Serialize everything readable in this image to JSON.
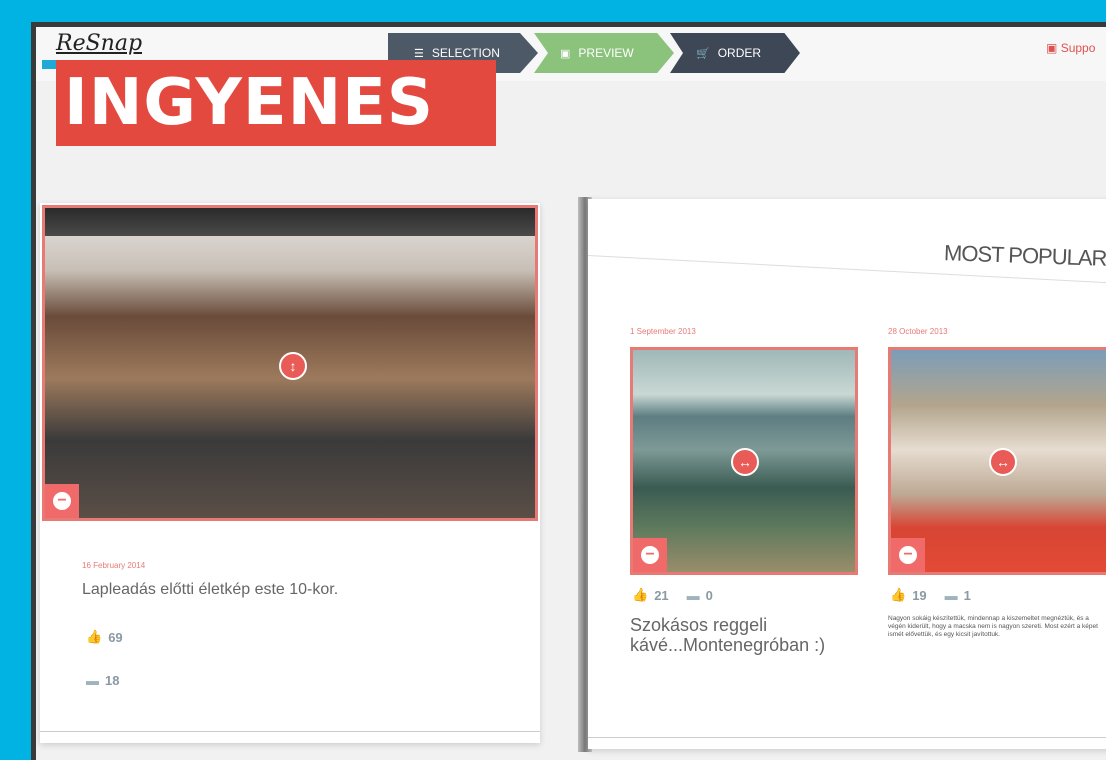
{
  "header": {
    "logo": "ReSnap",
    "steps": [
      {
        "label": "SELECTION",
        "icon": "list-icon"
      },
      {
        "label": "PREVIEW",
        "icon": "image-icon"
      },
      {
        "label": "ORDER",
        "icon": "cart-icon"
      }
    ],
    "support": "Suppo"
  },
  "badge": "INGYENES",
  "left_page": {
    "date": "16 February 2014",
    "caption": "Lapleadás előtti életkép este 10-kor.",
    "likes": "69",
    "comments": "18"
  },
  "right_page": {
    "heading": "MOST POPULAR",
    "cards": [
      {
        "date": "1 September 2013",
        "likes": "21",
        "comments": "0",
        "caption": "Szokásos reggeli kávé...Montenegróban :)"
      },
      {
        "date": "28 October 2013",
        "likes": "19",
        "comments": "1",
        "caption": "Nagyon sokáig készítettük, mindennap a kiszemeltet megnéztük, és a végén kiderült, hogy a macska nem is nagyon szereti. Most ezért a képet ismét elővettük, és egy kicsit javítottuk."
      }
    ]
  },
  "colors": {
    "background": "#00b3e3",
    "accent": "#e4493f",
    "preview_step": "#8cc37c"
  }
}
